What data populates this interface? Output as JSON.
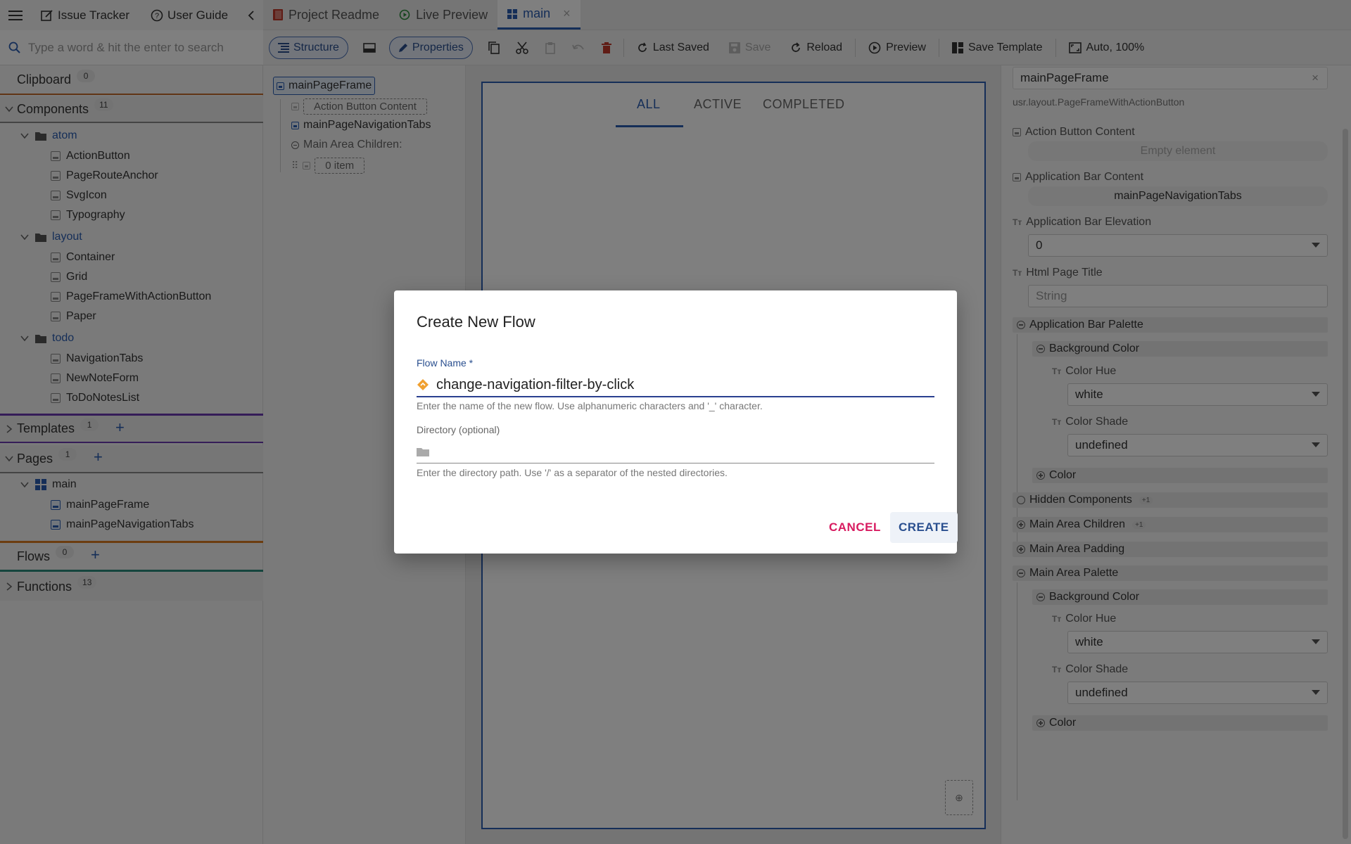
{
  "left_top": {
    "issue_tracker": "Issue Tracker",
    "user_guide": "User Guide"
  },
  "search": {
    "placeholder": "Type a word & hit the enter to search"
  },
  "sections": {
    "clipboard": {
      "label": "Clipboard",
      "count": "0"
    },
    "components": {
      "label": "Components",
      "count": "11"
    },
    "templates": {
      "label": "Templates",
      "count": "1"
    },
    "pages": {
      "label": "Pages",
      "count": "1"
    },
    "flows": {
      "label": "Flows",
      "count": "0"
    },
    "functions": {
      "label": "Functions",
      "count": "13"
    }
  },
  "components_tree": {
    "atom": "atom",
    "atom_items": [
      "ActionButton",
      "PageRouteAnchor",
      "SvgIcon",
      "Typography"
    ],
    "layout": "layout",
    "layout_items": [
      "Container",
      "Grid",
      "PageFrameWithActionButton",
      "Paper"
    ],
    "todo": "todo",
    "todo_items": [
      "NavigationTabs",
      "NewNoteForm",
      "ToDoNotesList"
    ]
  },
  "pages_tree": {
    "main": "main",
    "items": [
      "mainPageFrame",
      "mainPageNavigationTabs"
    ]
  },
  "tabs": [
    {
      "label": "Project Readme"
    },
    {
      "label": "Live Preview"
    },
    {
      "label": "main"
    }
  ],
  "toolbar": {
    "structure": "Structure",
    "properties": "Properties",
    "last_saved": "Last Saved",
    "save": "Save",
    "reload": "Reload",
    "preview": "Preview",
    "save_template": "Save Template",
    "zoom": "Auto, 100%"
  },
  "structure": {
    "root": "mainPageFrame",
    "action_button_content": "Action Button Content",
    "nav_tabs": "mainPageNavigationTabs",
    "main_area_children": "Main Area Children:",
    "item_count": "0 item"
  },
  "canvas": {
    "tabs": [
      "ALL",
      "ACTIVE",
      "COMPLETED"
    ]
  },
  "properties": {
    "component_name": "mainPageFrame",
    "component_type": "usr.layout.PageFrameWithActionButton",
    "action_button_content": "Action Button Content",
    "empty_element": "Empty element",
    "application_bar_content": "Application Bar Content",
    "application_bar_content_value": "mainPageNavigationTabs",
    "application_bar_elevation": "Application Bar Elevation",
    "elevation_value": "0",
    "html_page_title": "Html Page Title",
    "html_page_title_placeholder": "String",
    "application_bar_palette": "Application Bar Palette",
    "background_color": "Background Color",
    "color_hue": "Color Hue",
    "hue_value": "white",
    "color_shade": "Color Shade",
    "shade_value": "undefined",
    "color": "Color",
    "hidden_components": "Hidden Components",
    "main_area_children": "Main Area Children",
    "main_area_padding": "Main Area Padding",
    "main_area_palette": "Main Area Palette",
    "plus_one": "+1"
  },
  "dialog": {
    "title": "Create New Flow",
    "flow_name_label": "Flow Name *",
    "flow_name_value": "change-navigation-filter-by-click",
    "flow_name_help": "Enter the name of the new flow. Use alphanumeric characters and '_' character.",
    "directory_label": "Directory (optional)",
    "directory_value": "",
    "directory_help": "Enter the directory path. Use '/' as a separator of the nested directories.",
    "cancel": "CANCEL",
    "create": "CREATE"
  },
  "colors": {
    "accent": "#2a5db0",
    "cancel": "#d81b60",
    "flow_icon": "#f0a030"
  }
}
